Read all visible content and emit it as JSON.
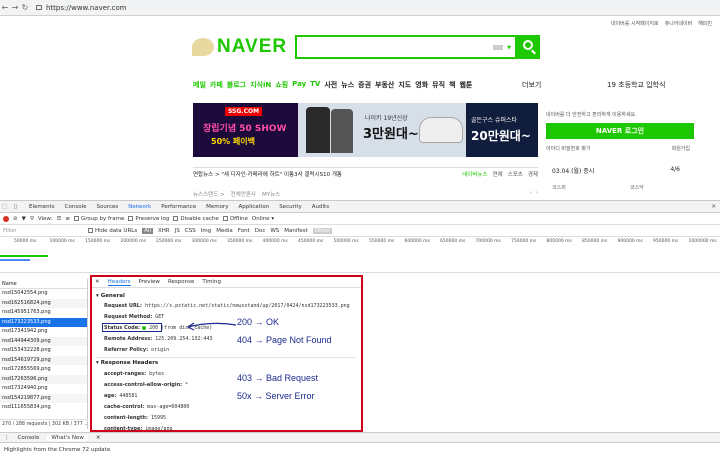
{
  "browser": {
    "url": "https://www.naver.com"
  },
  "naver": {
    "top_links": [
      "네이버를 시작페이지로",
      "쥬니어네이버",
      "해피빈"
    ],
    "logo_text": "NAVER",
    "menu": [
      "메일",
      "카페",
      "블로그",
      "지식iN",
      "쇼핑",
      "Pay",
      "TV",
      "사전",
      "뉴스",
      "증권",
      "부동산",
      "지도",
      "영화",
      "뮤직",
      "책",
      "웹툰"
    ],
    "more_label": "더보기",
    "top_news": "19 초등학교 입학식",
    "banner": {
      "brand": "SSG.COM",
      "left_line1": "창립기념 50 SHOW",
      "left_line2": "50% 페이백",
      "mid_small": "나이키 19년신상",
      "mid_big": "3만원대~",
      "right_small": "골든구스 슈퍼스타",
      "right_big": "20만원대~"
    },
    "login": {
      "message": "네이버를 더 안전하고 편리하게 이용하세요.",
      "button": "NAVER 로그인",
      "find": "아이디 비밀번호 찾기",
      "join": "회원가입"
    },
    "news": {
      "headline": "연합뉴스 > \"새 디자인·카메라에 하트\" 이통3사 갤럭시S10 개통",
      "tabs": [
        "네이버뉴스",
        "연예",
        "스포츠",
        "경제"
      ],
      "subline": [
        "뉴스스탠드 >",
        "전체언론사",
        "MY뉴스"
      ]
    },
    "stock": {
      "date": "03.04.(월)",
      "label": "증시",
      "page": "4/6",
      "k1": "코스피",
      "k2": "코스닥"
    }
  },
  "devtools": {
    "tabs": [
      "Elements",
      "Console",
      "Sources",
      "Network",
      "Performance",
      "Memory",
      "Application",
      "Security",
      "Audits"
    ],
    "active_tab": "Network",
    "toolbar": {
      "view_label": "View:",
      "group_by_frame": "Group by frame",
      "preserve_log": "Preserve log",
      "disable_cache": "Disable cache",
      "offline": "Offline",
      "online": "Online"
    },
    "filter": {
      "placeholder": "Filter",
      "hide_data_urls": "Hide data URLs",
      "types": [
        "All",
        "XHR",
        "JS",
        "CSS",
        "Img",
        "Media",
        "Font",
        "Doc",
        "WS",
        "Manifest",
        "Other"
      ]
    },
    "timeline_ticks": [
      "50000 ms",
      "100000 ms",
      "150000 ms",
      "200000 ms",
      "250000 ms",
      "300000 ms",
      "350000 ms",
      "400000 ms",
      "450000 ms",
      "500000 ms",
      "550000 ms",
      "600000 ms",
      "650000 ms",
      "700000 ms",
      "750000 ms",
      "800000 ms",
      "850000 ms",
      "900000 ms",
      "950000 ms",
      "1000000 ms"
    ],
    "name_header": "Name",
    "files": [
      "nsd15042554.png",
      "nsd162516824.png",
      "nsd145951763.png",
      "nsd173223533.png",
      "nsd17341942.png",
      "nsd144944309.png",
      "nsd153432228.png",
      "nsd154619729.png",
      "nsd172855569.png",
      "nsd17263596.png",
      "nsd17324940.png",
      "nsd154219877.png",
      "nsd111655834.png"
    ],
    "selected_file": "nsd173223533.png",
    "request_stats": "270 / 288 requests | 302 KB / 377 ...",
    "drawer_tabs": [
      "Console",
      "What's New"
    ],
    "drawer_active": "What's New",
    "highlights": "Highlights from the Chrome 72 update"
  },
  "headers_panel": {
    "tabs": [
      "Headers",
      "Preview",
      "Response",
      "Timing"
    ],
    "active_tab": "Headers",
    "general_title": "General",
    "general": [
      {
        "key": "Request URL:",
        "value": "https://s.pstatic.net/static/newsstand/up/2017/0424/nsd173223533.png"
      },
      {
        "key": "Request Method:",
        "value": "GET"
      },
      {
        "key": "Status Code:",
        "value": "200",
        "extra": "(from disk cache)"
      },
      {
        "key": "Remote Address:",
        "value": "125.209.254.132:443"
      },
      {
        "key": "Referrer Policy:",
        "value": "origin"
      }
    ],
    "response_title": "Response Headers",
    "response": [
      {
        "key": "accept-ranges:",
        "value": "bytes"
      },
      {
        "key": "access-control-allow-origin:",
        "value": "*"
      },
      {
        "key": "age:",
        "value": "448581"
      },
      {
        "key": "cache-control:",
        "value": "max-age=604800"
      },
      {
        "key": "content-length:",
        "value": "15995"
      },
      {
        "key": "content-type:",
        "value": "image/png"
      }
    ]
  },
  "annotations": {
    "ok": "200 → OK",
    "not_found": "404 → Page Not Found",
    "bad_request": "403 → Bad Request",
    "server_error": "50x → Server Error"
  },
  "colors": {
    "naver_green": "#1ec800",
    "highlight_red": "#d0021b",
    "annotation_blue": "#1b2a8c",
    "devtools_blue": "#1a73e8"
  }
}
